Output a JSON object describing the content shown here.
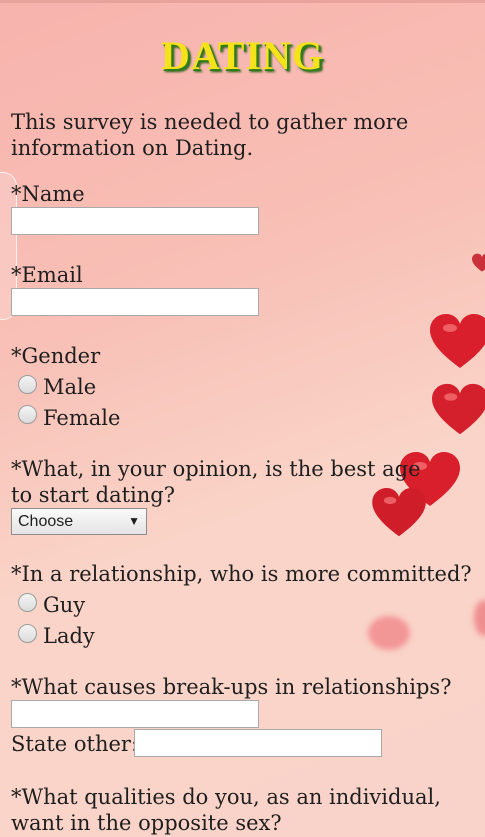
{
  "title": "DATING",
  "intro": "This survey is needed to gather more information on Dating.",
  "fields": {
    "name_label": "*Name",
    "name_value": "",
    "email_label": "*Email",
    "email_value": ""
  },
  "gender": {
    "label": "*Gender",
    "options": [
      "Male",
      "Female"
    ]
  },
  "age": {
    "label": "*What, in your opinion, is the best age to start dating?",
    "selected": "Choose"
  },
  "committed": {
    "label": "*In a relationship, who is more committed?",
    "options": [
      "Guy",
      "Lady"
    ]
  },
  "breakups": {
    "label": "*What causes break-ups in relationships?",
    "value": "",
    "state_other_label": "State other:",
    "state_other_value": ""
  },
  "qualities": {
    "label": "*What qualities do you, as an individual, want in the opposite sex?"
  },
  "colors": {
    "title_fill": "#f5e21a",
    "title_shadow": "#2f7d1a",
    "heart": "#d91f2b"
  }
}
